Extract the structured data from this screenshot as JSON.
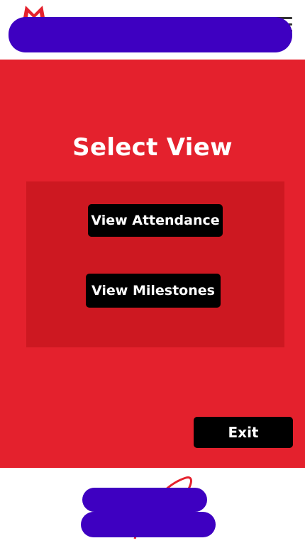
{
  "header": {
    "logo_icon": "brand-logo-icon",
    "menu_icon": "hamburger-menu-icon"
  },
  "main": {
    "title": "Select View",
    "buttons": {
      "attendance": "View Attendance",
      "milestones": "View Milestones"
    },
    "exit_label": "Exit"
  },
  "colors": {
    "panel_red": "#e4212d",
    "inner_red": "#cd1821",
    "button_black": "#000000",
    "redaction": "#3e00c1"
  }
}
